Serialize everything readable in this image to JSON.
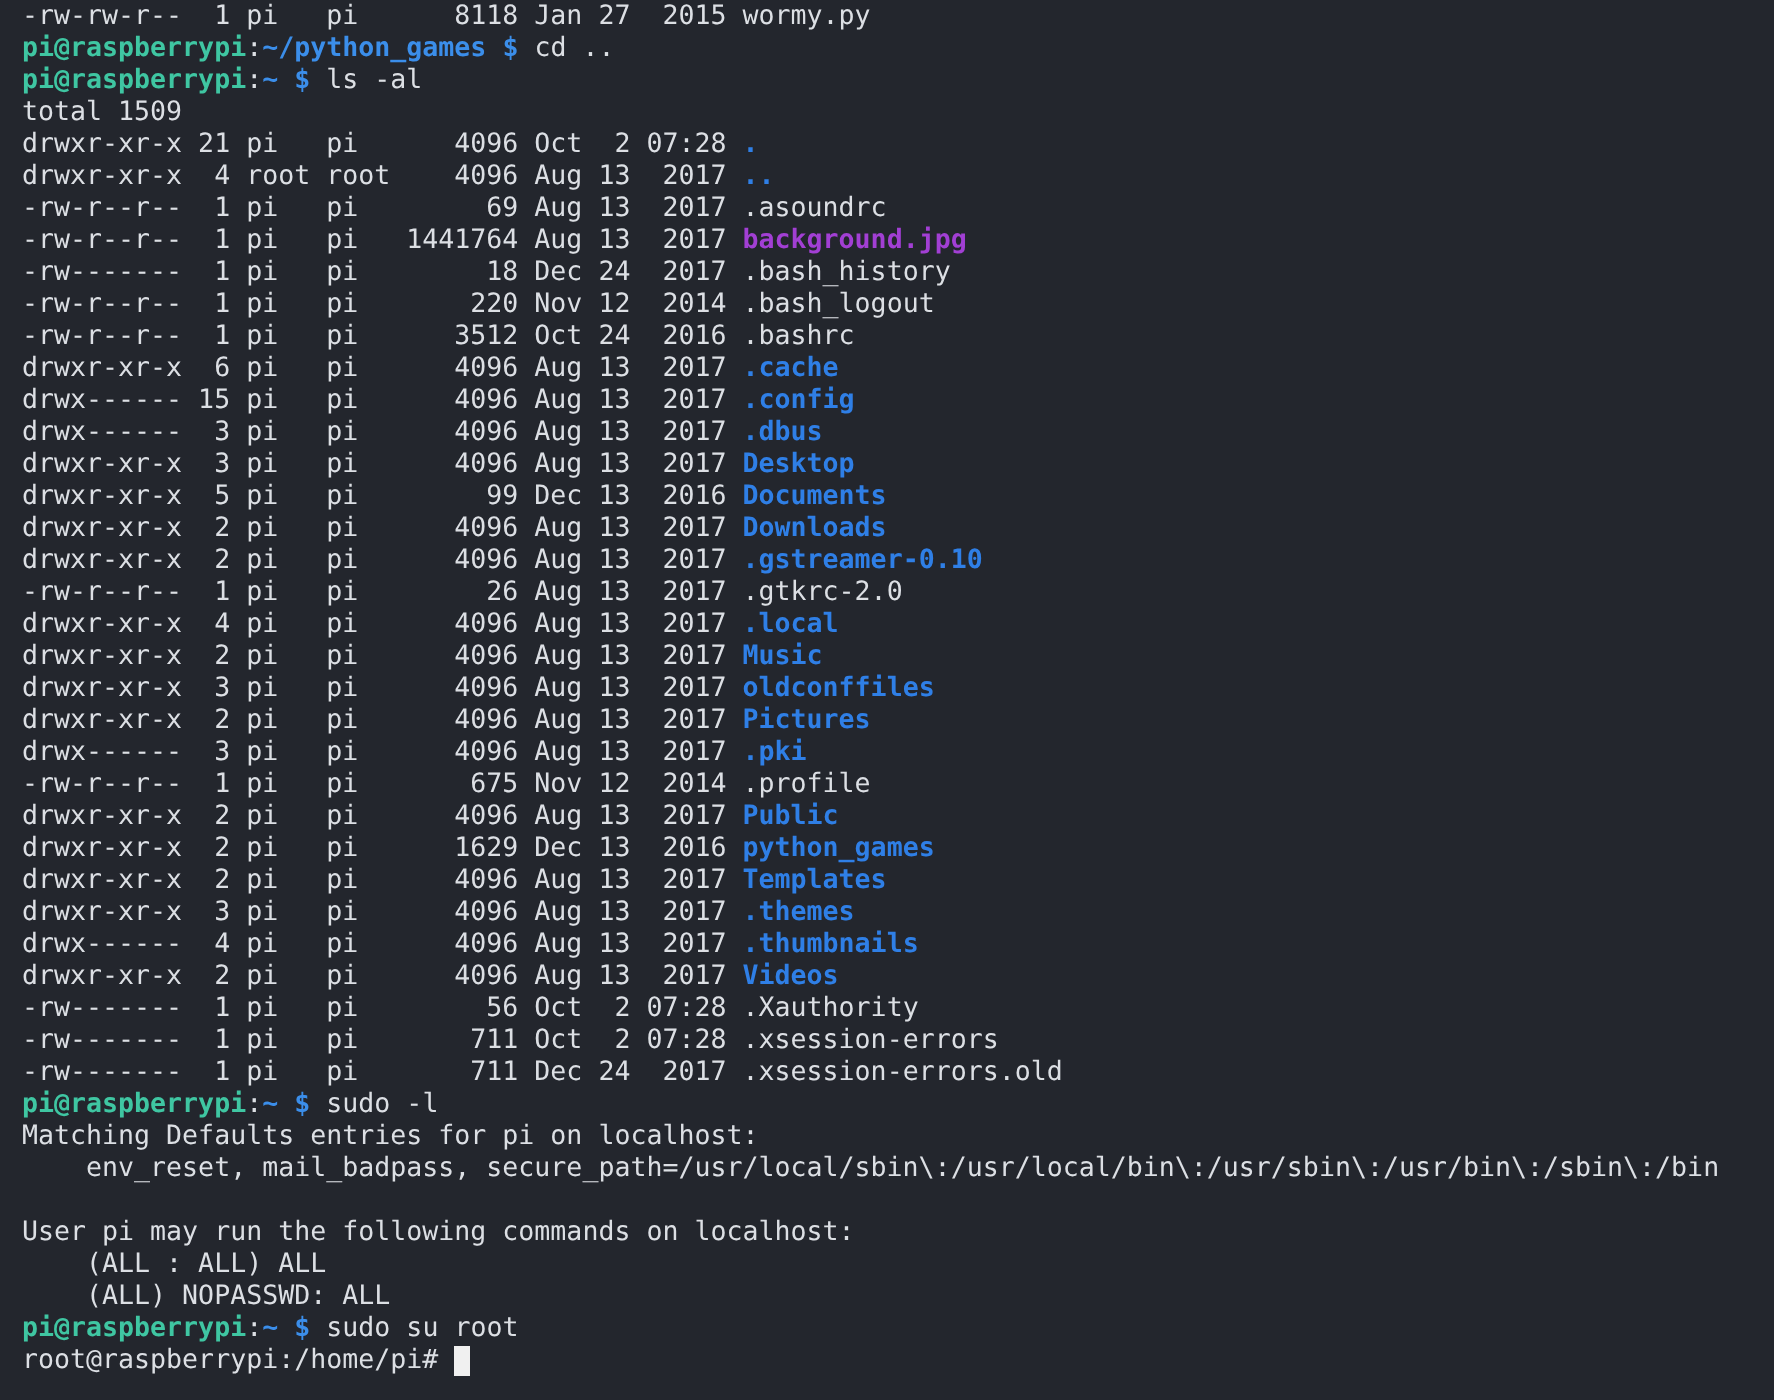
{
  "terminal": {
    "lines": [
      {
        "kind": "file",
        "info": "-rw-rw-r--  1 pi   pi      8118 Jan 27  2015",
        "name": "wormy.py"
      },
      {
        "kind": "prompt",
        "user": "pi@raspberrypi",
        "separator": ":",
        "path": "~/python_games",
        "symbol": "$",
        "command": "cd .."
      },
      {
        "kind": "prompt",
        "user": "pi@raspberrypi",
        "separator": ":",
        "path": "~",
        "symbol": "$",
        "command": "ls -al"
      },
      {
        "kind": "output",
        "text": "total 1509"
      },
      {
        "kind": "dir",
        "info": "drwxr-xr-x 21 pi   pi      4096 Oct  2 07:28",
        "name": "."
      },
      {
        "kind": "dir",
        "info": "drwxr-xr-x  4 root root    4096 Aug 13  2017",
        "name": ".."
      },
      {
        "kind": "file",
        "info": "-rw-r--r--  1 pi   pi        69 Aug 13  2017",
        "name": ".asoundrc"
      },
      {
        "kind": "image",
        "info": "-rw-r--r--  1 pi   pi   1441764 Aug 13  2017",
        "name": "background.jpg"
      },
      {
        "kind": "file",
        "info": "-rw-------  1 pi   pi        18 Dec 24  2017",
        "name": ".bash_history"
      },
      {
        "kind": "file",
        "info": "-rw-r--r--  1 pi   pi       220 Nov 12  2014",
        "name": ".bash_logout"
      },
      {
        "kind": "file",
        "info": "-rw-r--r--  1 pi   pi      3512 Oct 24  2016",
        "name": ".bashrc"
      },
      {
        "kind": "dir",
        "info": "drwxr-xr-x  6 pi   pi      4096 Aug 13  2017",
        "name": ".cache"
      },
      {
        "kind": "dir",
        "info": "drwx------ 15 pi   pi      4096 Aug 13  2017",
        "name": ".config"
      },
      {
        "kind": "dir",
        "info": "drwx------  3 pi   pi      4096 Aug 13  2017",
        "name": ".dbus"
      },
      {
        "kind": "dir",
        "info": "drwxr-xr-x  3 pi   pi      4096 Aug 13  2017",
        "name": "Desktop"
      },
      {
        "kind": "dir",
        "info": "drwxr-xr-x  5 pi   pi        99 Dec 13  2016",
        "name": "Documents"
      },
      {
        "kind": "dir",
        "info": "drwxr-xr-x  2 pi   pi      4096 Aug 13  2017",
        "name": "Downloads"
      },
      {
        "kind": "dir",
        "info": "drwxr-xr-x  2 pi   pi      4096 Aug 13  2017",
        "name": ".gstreamer-0.10"
      },
      {
        "kind": "file",
        "info": "-rw-r--r--  1 pi   pi        26 Aug 13  2017",
        "name": ".gtkrc-2.0"
      },
      {
        "kind": "dir",
        "info": "drwxr-xr-x  4 pi   pi      4096 Aug 13  2017",
        "name": ".local"
      },
      {
        "kind": "dir",
        "info": "drwxr-xr-x  2 pi   pi      4096 Aug 13  2017",
        "name": "Music"
      },
      {
        "kind": "dir",
        "info": "drwxr-xr-x  3 pi   pi      4096 Aug 13  2017",
        "name": "oldconffiles"
      },
      {
        "kind": "dir",
        "info": "drwxr-xr-x  2 pi   pi      4096 Aug 13  2017",
        "name": "Pictures"
      },
      {
        "kind": "dir",
        "info": "drwx------  3 pi   pi      4096 Aug 13  2017",
        "name": ".pki"
      },
      {
        "kind": "file",
        "info": "-rw-r--r--  1 pi   pi       675 Nov 12  2014",
        "name": ".profile"
      },
      {
        "kind": "dir",
        "info": "drwxr-xr-x  2 pi   pi      4096 Aug 13  2017",
        "name": "Public"
      },
      {
        "kind": "dir",
        "info": "drwxr-xr-x  2 pi   pi      1629 Dec 13  2016",
        "name": "python_games"
      },
      {
        "kind": "dir",
        "info": "drwxr-xr-x  2 pi   pi      4096 Aug 13  2017",
        "name": "Templates"
      },
      {
        "kind": "dir",
        "info": "drwxr-xr-x  3 pi   pi      4096 Aug 13  2017",
        "name": ".themes"
      },
      {
        "kind": "dir",
        "info": "drwx------  4 pi   pi      4096 Aug 13  2017",
        "name": ".thumbnails"
      },
      {
        "kind": "dir",
        "info": "drwxr-xr-x  2 pi   pi      4096 Aug 13  2017",
        "name": "Videos"
      },
      {
        "kind": "file",
        "info": "-rw-------  1 pi   pi        56 Oct  2 07:28",
        "name": ".Xauthority"
      },
      {
        "kind": "file",
        "info": "-rw-------  1 pi   pi       711 Oct  2 07:28",
        "name": ".xsession-errors"
      },
      {
        "kind": "file",
        "info": "-rw-------  1 pi   pi       711 Dec 24  2017",
        "name": ".xsession-errors.old"
      },
      {
        "kind": "prompt",
        "user": "pi@raspberrypi",
        "separator": ":",
        "path": "~",
        "symbol": "$",
        "command": "sudo -l"
      },
      {
        "kind": "output",
        "text": "Matching Defaults entries for pi on localhost:"
      },
      {
        "kind": "output",
        "text": "    env_reset, mail_badpass, secure_path=/usr/local/sbin\\:/usr/local/bin\\:/usr/sbin\\:/usr/bin\\:/sbin\\:/bin"
      },
      {
        "kind": "blank"
      },
      {
        "kind": "output",
        "text": "User pi may run the following commands on localhost:"
      },
      {
        "kind": "output",
        "text": "    (ALL : ALL) ALL"
      },
      {
        "kind": "output",
        "text": "    (ALL) NOPASSWD: ALL"
      },
      {
        "kind": "prompt",
        "user": "pi@raspberrypi",
        "separator": ":",
        "path": "~",
        "symbol": "$",
        "command": "sudo su root"
      },
      {
        "kind": "root_prompt",
        "text": "root@raspberrypi:/home/pi#"
      }
    ]
  }
}
